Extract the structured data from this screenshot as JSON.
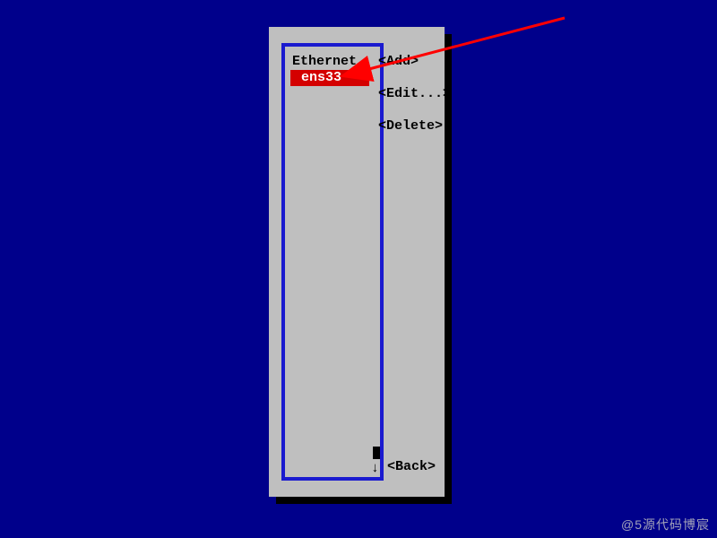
{
  "list": {
    "header": "Ethernet",
    "items": [
      "ens33"
    ]
  },
  "actions": {
    "add": "<Add>",
    "edit": "<Edit...>",
    "delete": "<Delete>",
    "back": "<Back>"
  },
  "scroll": {
    "down_arrow": "↓"
  },
  "watermark": "@5源代码博宸"
}
